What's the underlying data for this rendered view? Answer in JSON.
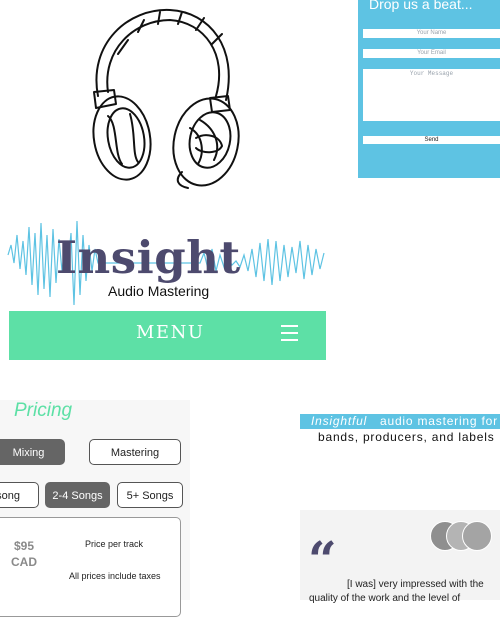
{
  "contact": {
    "title": "Drop us a beat...",
    "name_placeholder": "Your Name",
    "email_placeholder": "Your Email",
    "message_placeholder": "Your Message",
    "send_label": "Send"
  },
  "logo": {
    "title": "Insight",
    "subtitle": "Audio Mastering"
  },
  "menu": {
    "label": "MENU"
  },
  "pricing": {
    "title": "Pricing",
    "service_tabs": [
      "Mixing",
      "Mastering"
    ],
    "active_service": "Mixing",
    "quantity_tabs": [
      "song",
      "2-4 Songs",
      "5+ Songs"
    ],
    "active_quantity": "2-4 Songs",
    "price": "$95 CAD",
    "price_label": "Price per track",
    "price_note": "All prices include taxes"
  },
  "tagline": {
    "emphasis": "Insightful",
    "line1_rest": "audio mastering for",
    "line2": "bands, producers, and labels"
  },
  "testimonial": {
    "quote_mark": "“",
    "text_line1": "[I was] very impressed with the",
    "text_line2": "quality of the work and the level of"
  },
  "colors": {
    "accent_blue": "#5ec3e3",
    "accent_green": "#5de0a6",
    "logo_purple": "#4d4a6e"
  }
}
